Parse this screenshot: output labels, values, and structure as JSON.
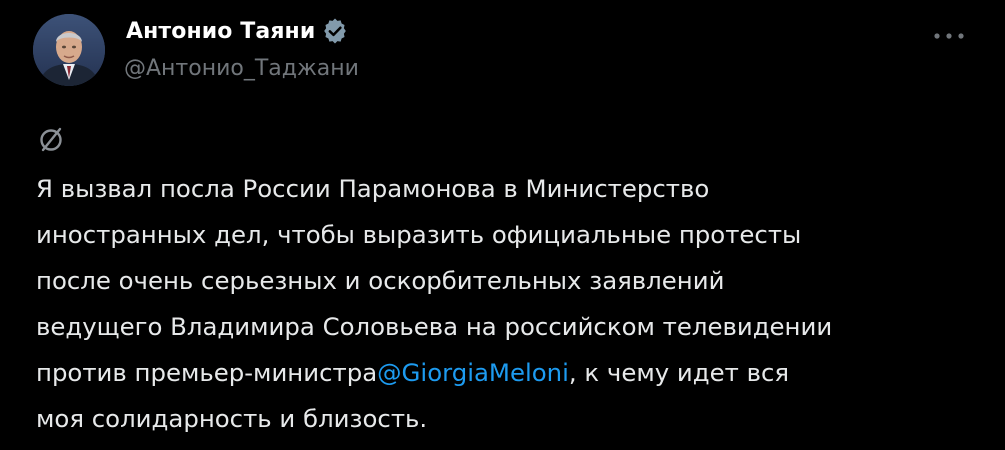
{
  "author": {
    "display_name": "Антонио Таяни",
    "handle": "@Антонио_Таджани",
    "verified_icon": "verified-badge-icon",
    "avatar_icon": "profile-avatar"
  },
  "header": {
    "more_icon": "more-options-icon"
  },
  "post": {
    "translated_icon": "no-entry-icon",
    "lines": {
      "l1": "Я вызвал посла России Парамонова в Министерство",
      "l2": "иностранных дел, чтобы выразить официальные протесты",
      "l3": "после очень серьезных и оскорбительных заявлений",
      "l4": "ведущего Владимира Соловьева на российском телевидении",
      "l5_before": "против премьер-министра",
      "l5_mention": "@GiorgiaMeloni",
      "l5_after": ", к чему идет вся",
      "l6": "моя солидарность и близость."
    }
  },
  "colors": {
    "background": "#000000",
    "text": "#e7e9ea",
    "secondary": "#71767b",
    "link": "#1d9bf0",
    "verified": "#829aab"
  }
}
